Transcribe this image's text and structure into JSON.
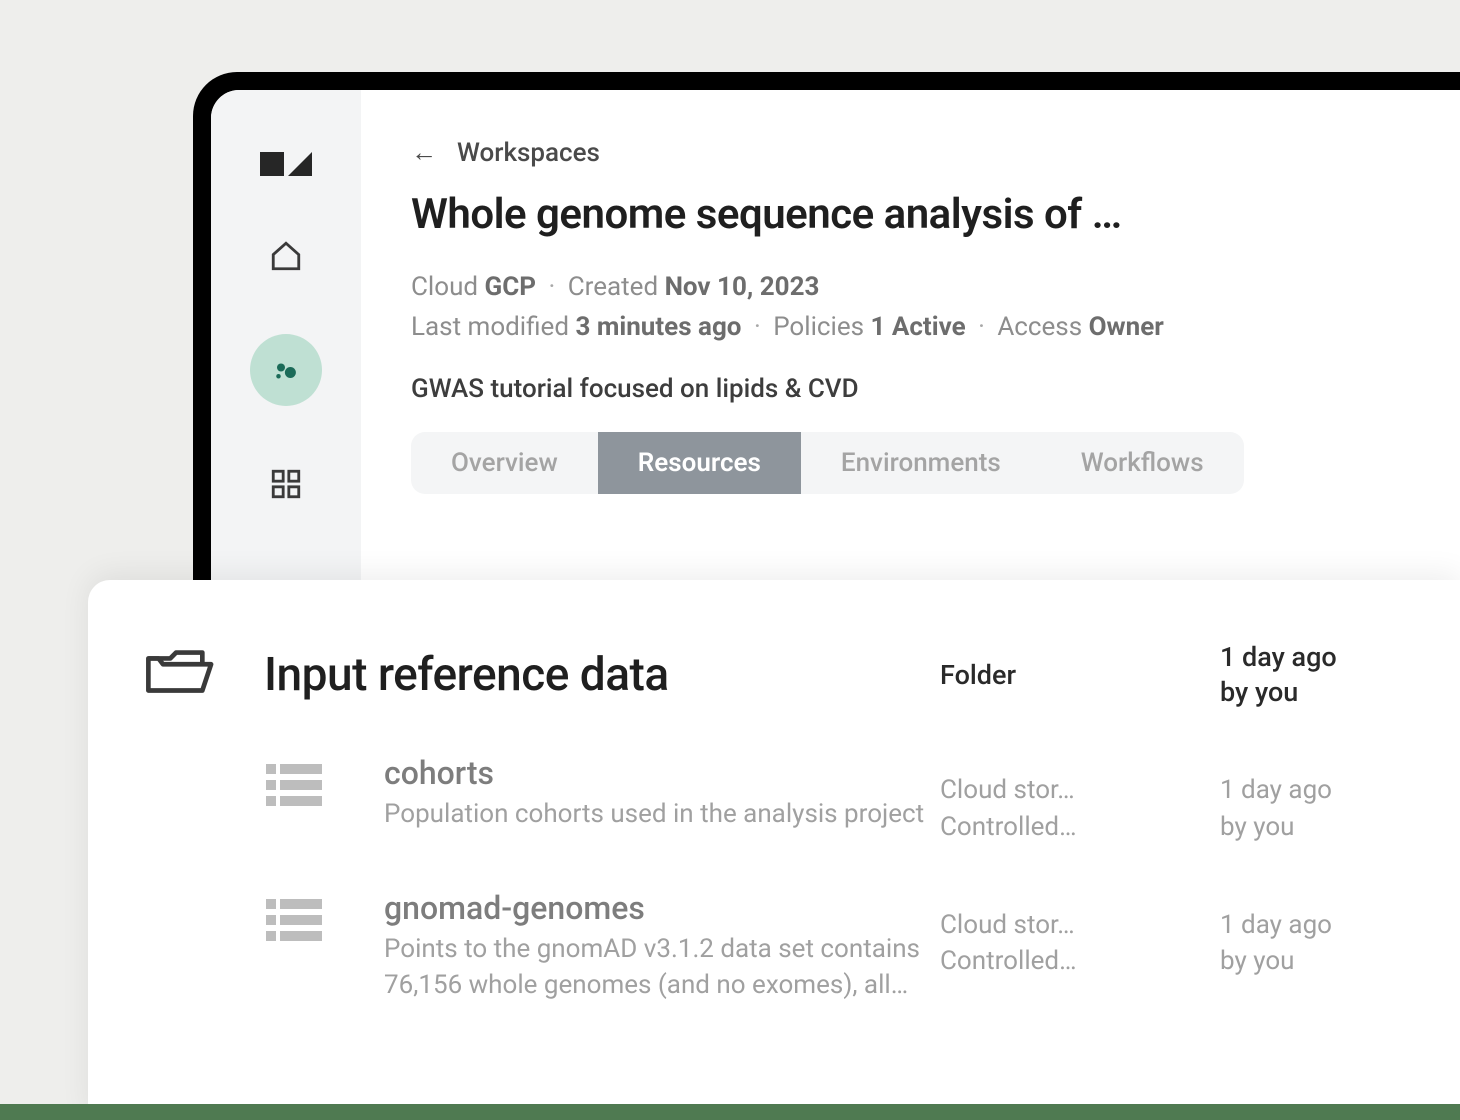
{
  "breadcrumb": {
    "back_label": "Workspaces"
  },
  "page": {
    "title": "Whole genome sequence analysis of …",
    "description": "GWAS tutorial focused on lipids & CVD"
  },
  "meta": {
    "cloud_label": "Cloud",
    "cloud_value": "GCP",
    "created_label": "Created",
    "created_value": "Nov 10, 2023",
    "modified_label": "Last modified",
    "modified_value": "3 minutes ago",
    "policies_label": "Policies",
    "policies_value": "1 Active",
    "access_label": "Access",
    "access_value": "Owner"
  },
  "tabs": {
    "overview": "Overview",
    "resources": "Resources",
    "environments": "Environments",
    "workflows": "Workflows"
  },
  "panel": {
    "title": "Input reference data",
    "type_label": "Folder",
    "time_line1": "1 day ago",
    "time_line2": "by you"
  },
  "rows": [
    {
      "title": "cohorts",
      "desc": "Population cohorts used in the analysis project",
      "type_line1": "Cloud stor…",
      "type_line2": "Controlled…",
      "time_line1": "1 day ago",
      "time_line2": "by you"
    },
    {
      "title": "gnomad-genomes",
      "desc": "Points to the gnomAD v3.1.2 data set contains 76,156 whole genomes (and no exomes), all…",
      "type_line1": "Cloud stor…",
      "type_line2": "Controlled…",
      "time_line1": "1 day ago",
      "time_line2": "by you"
    }
  ]
}
